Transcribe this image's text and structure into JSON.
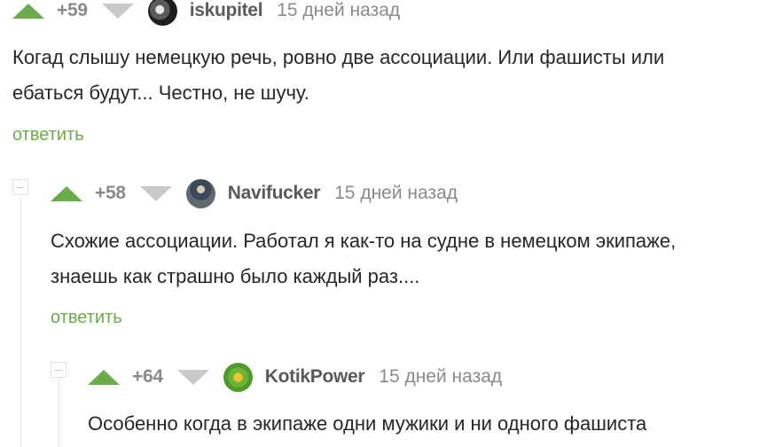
{
  "comments": [
    {
      "rating": "+59",
      "user": "iskupitel",
      "time": "15 дней назад",
      "lines": [
        "Когад слышу немецкую речь, ровно две ассоциации. Или фашисты или",
        "ебаться будут... Честно, не шучу."
      ],
      "reply": "ответить"
    },
    {
      "rating": "+58",
      "user": "Navifucker",
      "time": "15 дней назад",
      "lines": [
        "Схожие ассоциации. Работал я как-то на судне в немецком экипаже,",
        "знаешь как страшно было каждый раз...."
      ],
      "reply": "ответить"
    },
    {
      "rating": "+64",
      "user": "KotikPower",
      "time": "15 дней назад",
      "lines": [
        "Особенно когда в экипаже одни мужики и ни одного фашиста"
      ]
    }
  ],
  "colors": {
    "upvote": "#6aac4a",
    "downvote": "#c9c9c9",
    "reply_link": "#6aac4a"
  },
  "icons": {
    "upvote": "upvote-arrow-icon",
    "downvote": "downvote-arrow-icon",
    "collapse": "collapse-thread-icon"
  }
}
